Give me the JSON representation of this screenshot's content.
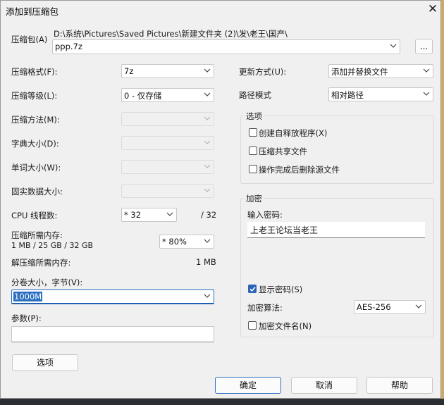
{
  "window": {
    "title": "添加到压缩包"
  },
  "archive": {
    "label": "压缩包(A)",
    "path": "D:\\系统\\Pictures\\Saved Pictures\\新建文件夹 (2)\\发\\老王\\国产\\",
    "filename": "ppp.7z",
    "browse_label": "..."
  },
  "left": {
    "format": {
      "label": "压缩格式(F):",
      "value": "7z"
    },
    "level": {
      "label": "压缩等级(L):",
      "value": "0 - 仅存储"
    },
    "method": {
      "label": "压缩方法(M):",
      "value": ""
    },
    "dict": {
      "label": "字典大小(D):",
      "value": ""
    },
    "word": {
      "label": "单词大小(W):",
      "value": ""
    },
    "solid": {
      "label": "固实数据大小:",
      "value": ""
    },
    "cpu": {
      "label": "CPU 线程数:",
      "value": "* 32",
      "max": "/ 32"
    },
    "mem": {
      "label": "压缩所需内存:",
      "detail": "1 MB / 25 GB / 32 GB",
      "value": "* 80%"
    },
    "demem": {
      "label": "解压缩所需内存:",
      "value": "1 MB"
    },
    "volume": {
      "label": "分卷大小，字节(V):",
      "value": "1000M"
    },
    "params": {
      "label": "参数(P):",
      "value": ""
    },
    "options_button": "选项"
  },
  "right": {
    "update": {
      "label": "更新方式(U):",
      "value": "添加并替换文件"
    },
    "pathmode": {
      "label": "路径模式",
      "value": "相对路径"
    },
    "options": {
      "title": "选项",
      "sfx": "创建自释放程序(X)",
      "shared": "压缩共享文件",
      "delete": "操作完成后删除源文件"
    },
    "encryption": {
      "title": "加密",
      "password_label": "输入密码:",
      "password_value": "上老王论坛当老王",
      "show_password": "显示密码(S)",
      "method_label": "加密算法:",
      "method_value": "AES-256",
      "encrypt_names": "加密文件名(N)"
    }
  },
  "footer": {
    "ok": "确定",
    "cancel": "取消",
    "help": "帮助"
  },
  "colors": {
    "accent": "#2a6fc0",
    "background": "#f0f0f0"
  }
}
